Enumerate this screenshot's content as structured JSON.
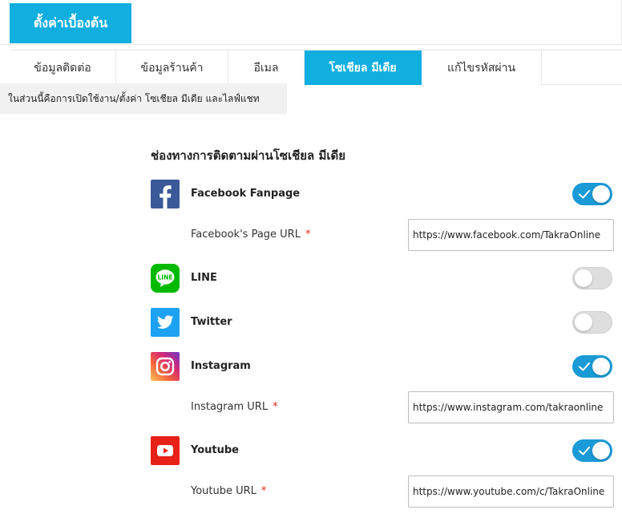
{
  "header": {
    "title": "ตั้งค่าเบื้องต้น"
  },
  "tabs": [
    {
      "label": "ข้อมูลติดต่อ",
      "active": false
    },
    {
      "label": "ข้อมูลร้านค้า",
      "active": false
    },
    {
      "label": "อีเมล",
      "active": false
    },
    {
      "label": "โซเชียล มีเดีย",
      "active": true
    },
    {
      "label": "แก้ไขรหัสผ่าน",
      "active": false
    }
  ],
  "info_note": "ในส่วนนี้คือการเปิดใช้งาน/ตั้งค่า โซเชียล มีเดีย และไลฟ์แชท",
  "section_title": "ช่องทางการติดตามผ่านโซเชียล มีเดีย",
  "accent_color": "#11aee0",
  "social": {
    "facebook": {
      "name": "Facebook Fanpage",
      "icon": "facebook-icon",
      "color": "#3b5998",
      "enabled": true,
      "url_label": "Facebook's Page URL",
      "required_mark": "*",
      "url_value": "https://www.facebook.com/TakraOnline"
    },
    "line": {
      "name": "LINE",
      "icon": "line-icon",
      "color": "#00b900",
      "enabled": false
    },
    "twitter": {
      "name": "Twitter",
      "icon": "twitter-icon",
      "color": "#1da1f2",
      "enabled": false
    },
    "instagram": {
      "name": "Instagram",
      "icon": "instagram-icon",
      "enabled": true,
      "url_label": "Instagram URL",
      "required_mark": "*",
      "url_value": "https://www.instagram.com/takraonline"
    },
    "youtube": {
      "name": "Youtube",
      "icon": "youtube-icon",
      "color": "#e62117",
      "enabled": true,
      "url_label": "Youtube URL",
      "required_mark": "*",
      "url_value": "https://www.youtube.com/c/TakraOnline"
    }
  }
}
